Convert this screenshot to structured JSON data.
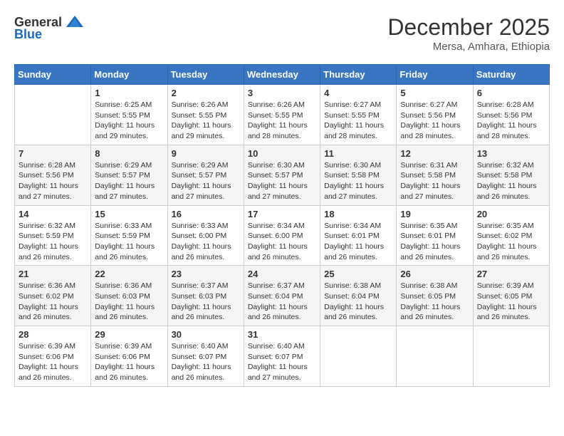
{
  "header": {
    "logo_general": "General",
    "logo_blue": "Blue",
    "month_year": "December 2025",
    "location": "Mersa, Amhara, Ethiopia"
  },
  "weekdays": [
    "Sunday",
    "Monday",
    "Tuesday",
    "Wednesday",
    "Thursday",
    "Friday",
    "Saturday"
  ],
  "weeks": [
    [
      {
        "day": "",
        "info": ""
      },
      {
        "day": "1",
        "info": "Sunrise: 6:25 AM\nSunset: 5:55 PM\nDaylight: 11 hours and 29 minutes."
      },
      {
        "day": "2",
        "info": "Sunrise: 6:26 AM\nSunset: 5:55 PM\nDaylight: 11 hours and 29 minutes."
      },
      {
        "day": "3",
        "info": "Sunrise: 6:26 AM\nSunset: 5:55 PM\nDaylight: 11 hours and 28 minutes."
      },
      {
        "day": "4",
        "info": "Sunrise: 6:27 AM\nSunset: 5:55 PM\nDaylight: 11 hours and 28 minutes."
      },
      {
        "day": "5",
        "info": "Sunrise: 6:27 AM\nSunset: 5:56 PM\nDaylight: 11 hours and 28 minutes."
      },
      {
        "day": "6",
        "info": "Sunrise: 6:28 AM\nSunset: 5:56 PM\nDaylight: 11 hours and 28 minutes."
      }
    ],
    [
      {
        "day": "7",
        "info": "Sunrise: 6:28 AM\nSunset: 5:56 PM\nDaylight: 11 hours and 27 minutes."
      },
      {
        "day": "8",
        "info": "Sunrise: 6:29 AM\nSunset: 5:57 PM\nDaylight: 11 hours and 27 minutes."
      },
      {
        "day": "9",
        "info": "Sunrise: 6:29 AM\nSunset: 5:57 PM\nDaylight: 11 hours and 27 minutes."
      },
      {
        "day": "10",
        "info": "Sunrise: 6:30 AM\nSunset: 5:57 PM\nDaylight: 11 hours and 27 minutes."
      },
      {
        "day": "11",
        "info": "Sunrise: 6:30 AM\nSunset: 5:58 PM\nDaylight: 11 hours and 27 minutes."
      },
      {
        "day": "12",
        "info": "Sunrise: 6:31 AM\nSunset: 5:58 PM\nDaylight: 11 hours and 27 minutes."
      },
      {
        "day": "13",
        "info": "Sunrise: 6:32 AM\nSunset: 5:58 PM\nDaylight: 11 hours and 26 minutes."
      }
    ],
    [
      {
        "day": "14",
        "info": "Sunrise: 6:32 AM\nSunset: 5:59 PM\nDaylight: 11 hours and 26 minutes."
      },
      {
        "day": "15",
        "info": "Sunrise: 6:33 AM\nSunset: 5:59 PM\nDaylight: 11 hours and 26 minutes."
      },
      {
        "day": "16",
        "info": "Sunrise: 6:33 AM\nSunset: 6:00 PM\nDaylight: 11 hours and 26 minutes."
      },
      {
        "day": "17",
        "info": "Sunrise: 6:34 AM\nSunset: 6:00 PM\nDaylight: 11 hours and 26 minutes."
      },
      {
        "day": "18",
        "info": "Sunrise: 6:34 AM\nSunset: 6:01 PM\nDaylight: 11 hours and 26 minutes."
      },
      {
        "day": "19",
        "info": "Sunrise: 6:35 AM\nSunset: 6:01 PM\nDaylight: 11 hours and 26 minutes."
      },
      {
        "day": "20",
        "info": "Sunrise: 6:35 AM\nSunset: 6:02 PM\nDaylight: 11 hours and 26 minutes."
      }
    ],
    [
      {
        "day": "21",
        "info": "Sunrise: 6:36 AM\nSunset: 6:02 PM\nDaylight: 11 hours and 26 minutes."
      },
      {
        "day": "22",
        "info": "Sunrise: 6:36 AM\nSunset: 6:03 PM\nDaylight: 11 hours and 26 minutes."
      },
      {
        "day": "23",
        "info": "Sunrise: 6:37 AM\nSunset: 6:03 PM\nDaylight: 11 hours and 26 minutes."
      },
      {
        "day": "24",
        "info": "Sunrise: 6:37 AM\nSunset: 6:04 PM\nDaylight: 11 hours and 26 minutes."
      },
      {
        "day": "25",
        "info": "Sunrise: 6:38 AM\nSunset: 6:04 PM\nDaylight: 11 hours and 26 minutes."
      },
      {
        "day": "26",
        "info": "Sunrise: 6:38 AM\nSunset: 6:05 PM\nDaylight: 11 hours and 26 minutes."
      },
      {
        "day": "27",
        "info": "Sunrise: 6:39 AM\nSunset: 6:05 PM\nDaylight: 11 hours and 26 minutes."
      }
    ],
    [
      {
        "day": "28",
        "info": "Sunrise: 6:39 AM\nSunset: 6:06 PM\nDaylight: 11 hours and 26 minutes."
      },
      {
        "day": "29",
        "info": "Sunrise: 6:39 AM\nSunset: 6:06 PM\nDaylight: 11 hours and 26 minutes."
      },
      {
        "day": "30",
        "info": "Sunrise: 6:40 AM\nSunset: 6:07 PM\nDaylight: 11 hours and 26 minutes."
      },
      {
        "day": "31",
        "info": "Sunrise: 6:40 AM\nSunset: 6:07 PM\nDaylight: 11 hours and 27 minutes."
      },
      {
        "day": "",
        "info": ""
      },
      {
        "day": "",
        "info": ""
      },
      {
        "day": "",
        "info": ""
      }
    ]
  ]
}
